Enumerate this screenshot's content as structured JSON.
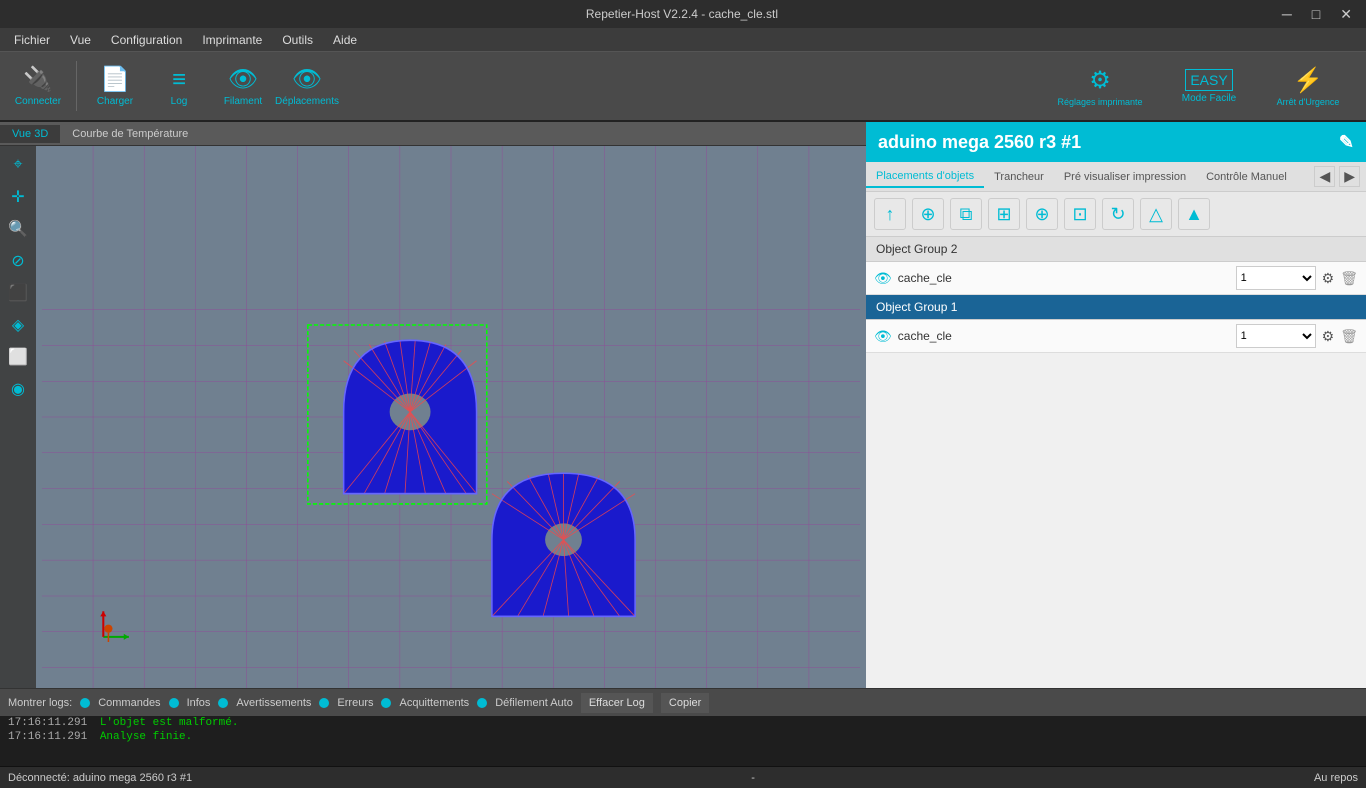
{
  "titlebar": {
    "title": "Repetier-Host V2.2.4 - cache_cle.stl",
    "min_btn": "─",
    "max_btn": "□",
    "close_btn": "✕"
  },
  "menubar": {
    "items": [
      "Fichier",
      "Vue",
      "Configuration",
      "Imprimante",
      "Outils",
      "Aide"
    ]
  },
  "toolbar": {
    "connecter_label": "Connecter",
    "charger_label": "Charger",
    "log_label": "Log",
    "filament_label": "Filament",
    "deplacements_label": "Déplacements",
    "reglages_label": "Réglages imprimante",
    "mode_facile_label": "Mode Facile",
    "arret_urgence_label": "Arrêt d'Urgence"
  },
  "view_tabs": {
    "tabs": [
      "Vue 3D",
      "Courbe de Température"
    ]
  },
  "printer_header": {
    "title": "aduino mega 2560 r3 #1"
  },
  "printer_tabs": {
    "tabs": [
      "Placements d'objets",
      "Trancheur",
      "Pré visualiser impression",
      "Contrôle Manuel"
    ]
  },
  "object_groups": [
    {
      "name": "Object Group 2",
      "selected": false,
      "objects": [
        {
          "name": "cache_cle",
          "visible": true,
          "count": "1"
        }
      ]
    },
    {
      "name": "Object Group 1",
      "selected": true,
      "objects": [
        {
          "name": "cache_cle",
          "visible": true,
          "count": "1"
        }
      ]
    }
  ],
  "log_lines": [
    {
      "time": "17:16:11.291",
      "msg": "L'objet est malformé."
    },
    {
      "time": "17:16:11.291",
      "msg": "Analyse finie."
    }
  ],
  "log_toolbar": {
    "montrer_logs": "Montrer logs:",
    "commandes": "Commandes",
    "infos": "Infos",
    "avertissements": "Avertissements",
    "erreurs": "Erreurs",
    "acquittements": "Acquittements",
    "defilement_auto": "Défilement Auto",
    "effacer_log": "Effacer Log",
    "copier": "Copier"
  },
  "statusbar": {
    "left": "Déconnecté: aduino mega 2560 r3 #1",
    "center": "-",
    "right": "Au repos"
  }
}
